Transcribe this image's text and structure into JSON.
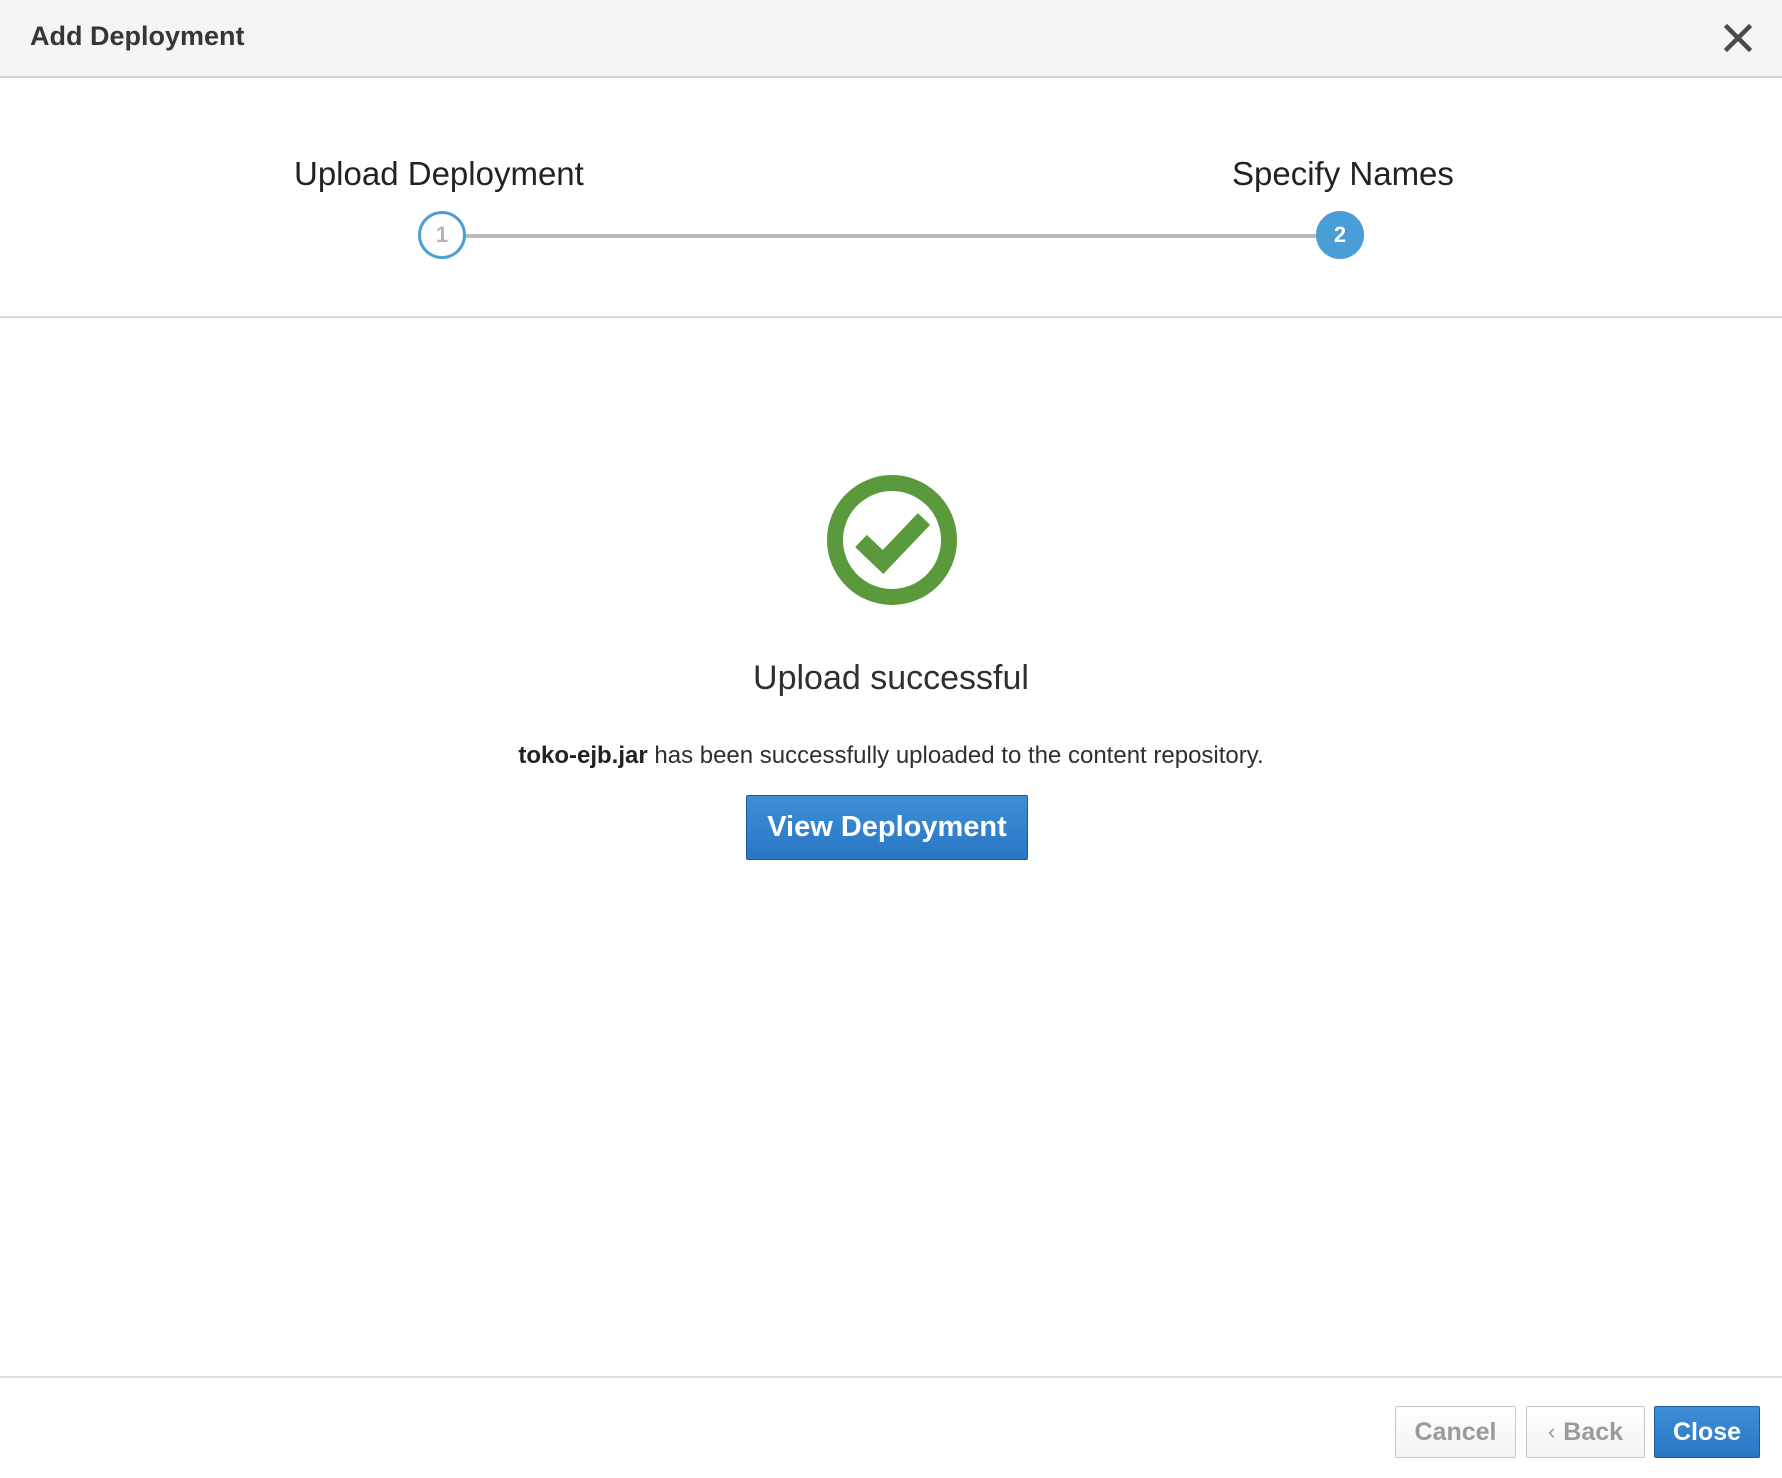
{
  "dialog": {
    "title": "Add Deployment"
  },
  "wizard": {
    "steps": [
      {
        "number": "1",
        "label": "Upload Deployment",
        "state": "completed"
      },
      {
        "number": "2",
        "label": "Specify Names",
        "state": "active"
      }
    ]
  },
  "result": {
    "icon": "check-circle-icon",
    "title": "Upload successful",
    "file_name": "toko-ejb.jar",
    "message": " has been successfully uploaded to the content repository.",
    "view_button": "View Deployment"
  },
  "footer": {
    "cancel_label": "Cancel",
    "back_icon": "chevron-left-icon",
    "back_label": "Back",
    "close_label": "Close"
  },
  "colors": {
    "accent": "#4a9ed8",
    "success": "#5a9a3c",
    "primary_button": "#2f7fcb"
  }
}
